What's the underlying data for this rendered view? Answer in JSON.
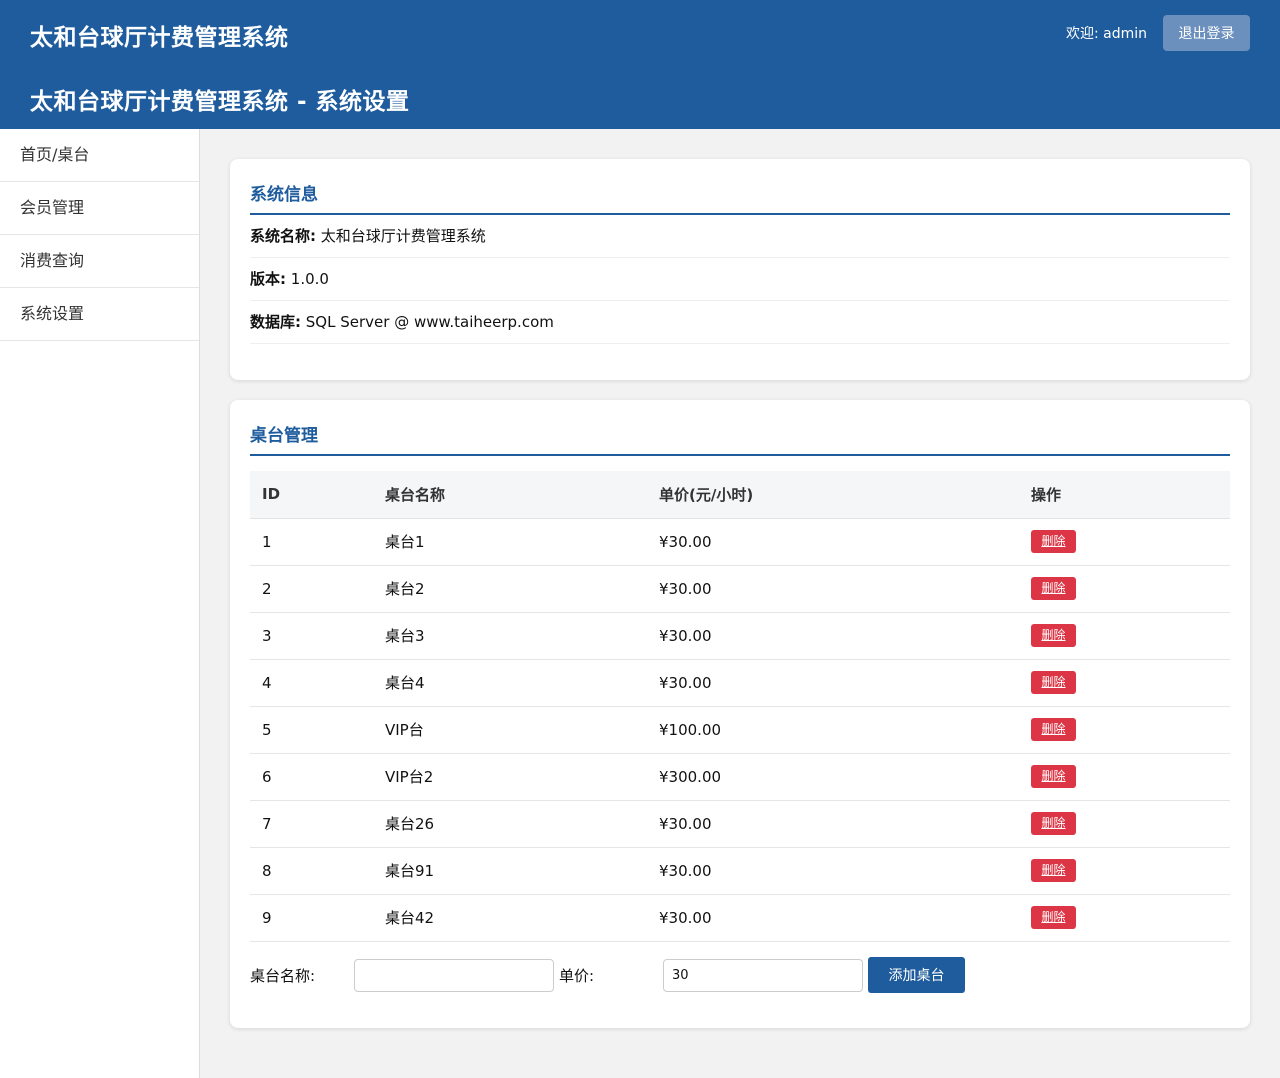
{
  "header": {
    "app_title": "太和台球厅计费管理系统",
    "page_title": "太和台球厅计费管理系统 - 系统设置",
    "welcome": "欢迎: admin",
    "logout_label": "退出登录"
  },
  "sidebar": {
    "items": [
      {
        "label": "首页/桌台"
      },
      {
        "label": "会员管理"
      },
      {
        "label": "消费查询"
      },
      {
        "label": "系统设置"
      }
    ]
  },
  "system_info": {
    "title": "系统信息",
    "rows": [
      {
        "label": "系统名称:",
        "value": "太和台球厅计费管理系统"
      },
      {
        "label": "版本:",
        "value": "1.0.0"
      },
      {
        "label": "数据库:",
        "value": "SQL Server @ www.taiheerp.com"
      }
    ]
  },
  "table_management": {
    "title": "桌台管理",
    "columns": [
      "ID",
      "桌台名称",
      "单价(元/小时)",
      "操作"
    ],
    "delete_label": "删除",
    "rows": [
      {
        "id": "1",
        "name": "桌台1",
        "price": "¥30.00"
      },
      {
        "id": "2",
        "name": "桌台2",
        "price": "¥30.00"
      },
      {
        "id": "3",
        "name": "桌台3",
        "price": "¥30.00"
      },
      {
        "id": "4",
        "name": "桌台4",
        "price": "¥30.00"
      },
      {
        "id": "5",
        "name": "VIP台",
        "price": "¥100.00"
      },
      {
        "id": "6",
        "name": "VIP台2",
        "price": "¥300.00"
      },
      {
        "id": "7",
        "name": "桌台26",
        "price": "¥30.00"
      },
      {
        "id": "8",
        "name": "桌台91",
        "price": "¥30.00"
      },
      {
        "id": "9",
        "name": "桌台42",
        "price": "¥30.00"
      }
    ],
    "form": {
      "name_label": "桌台名称:",
      "name_value": "",
      "price_label": "单价:",
      "price_value": "30",
      "add_label": "添加桌台"
    }
  },
  "colors": {
    "primary": "#1e5c9e",
    "danger": "#dc3545",
    "logout": "#6b90bd"
  }
}
